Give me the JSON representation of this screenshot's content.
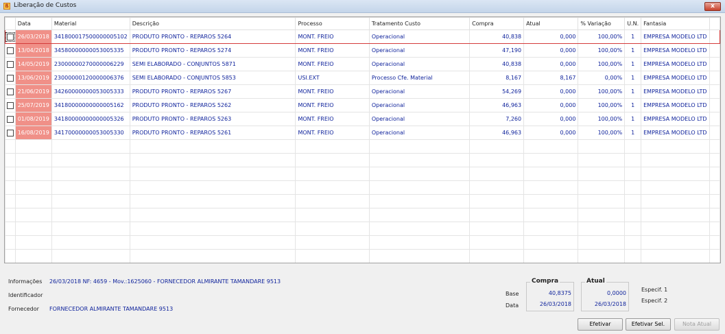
{
  "window": {
    "title": "Liberação de Custos",
    "close_label": "x"
  },
  "grid": {
    "columns": [
      "Data",
      "Material",
      "Descrição",
      "Processo",
      "Tratamento Custo",
      "Compra",
      "Atual",
      "% Variação",
      "U.N.",
      "Fantasia"
    ],
    "rows": [
      {
        "data": "26/03/2018",
        "material": "341800017500000005102",
        "descricao": "PRODUTO PRONTO - REPAROS 5264",
        "processo": "MONT. FREIO",
        "tratamento": "Operacional",
        "compra": "40,838",
        "atual": "0,000",
        "variacao": "100,00%",
        "un": "1",
        "fantasia": "EMPRESA MODELO LTD"
      },
      {
        "data": "13/04/2018",
        "material": "34580000000053005335",
        "descricao": "PRODUTO PRONTO - REPAROS 5274",
        "processo": "MONT. FREIO",
        "tratamento": "Operacional",
        "compra": "47,190",
        "atual": "0,000",
        "variacao": "100,00%",
        "un": "1",
        "fantasia": "EMPRESA MODELO LTD"
      },
      {
        "data": "14/05/2019",
        "material": "23000000270000006229",
        "descricao": "SEMI ELABORADO - CONJUNTOS 5871",
        "processo": "MONT. FREIO",
        "tratamento": "Operacional",
        "compra": "40,838",
        "atual": "0,000",
        "variacao": "100,00%",
        "un": "1",
        "fantasia": "EMPRESA MODELO LTD"
      },
      {
        "data": "13/06/2019",
        "material": "23000000120000006376",
        "descricao": "SEMI ELABORADO - CONJUNTOS 5853",
        "processo": "USI.EXT",
        "tratamento": "Processo Cfe. Material",
        "compra": "8,167",
        "atual": "8,167",
        "variacao": "0,00%",
        "un": "1",
        "fantasia": "EMPRESA MODELO LTD"
      },
      {
        "data": "21/06/2019",
        "material": "34260000000053005333",
        "descricao": "PRODUTO PRONTO - REPAROS 5267",
        "processo": "MONT. FREIO",
        "tratamento": "Operacional",
        "compra": "54,269",
        "atual": "0,000",
        "variacao": "100,00%",
        "un": "1",
        "fantasia": "EMPRESA MODELO LTD"
      },
      {
        "data": "25/07/2019",
        "material": "34180000000000005162",
        "descricao": "PRODUTO PRONTO - REPAROS 5262",
        "processo": "MONT. FREIO",
        "tratamento": "Operacional",
        "compra": "46,963",
        "atual": "0,000",
        "variacao": "100,00%",
        "un": "1",
        "fantasia": "EMPRESA MODELO LTD"
      },
      {
        "data": "01/08/2019",
        "material": "34180000000000005326",
        "descricao": "PRODUTO PRONTO - REPAROS 5263",
        "processo": "MONT. FREIO",
        "tratamento": "Operacional",
        "compra": "7,260",
        "atual": "0,000",
        "variacao": "100,00%",
        "un": "1",
        "fantasia": "EMPRESA MODELO LTD"
      },
      {
        "data": "16/08/2019",
        "material": "34170000000053005330",
        "descricao": "PRODUTO PRONTO - REPAROS 5261",
        "processo": "MONT. FREIO",
        "tratamento": "Operacional",
        "compra": "46,963",
        "atual": "0,000",
        "variacao": "100,00%",
        "un": "1",
        "fantasia": "EMPRESA MODELO LTD"
      }
    ],
    "empty_rows": 9
  },
  "info": {
    "informacoes_label": "Informações",
    "informacoes_value": "26/03/2018 NF: 4659 - Mov.:1625060 - FORNECEDOR ALMIRANTE TAMANDARE 9513",
    "identificador_label": "Identificador",
    "identificador_value": "",
    "fornecedor_label": "Fornecedor",
    "fornecedor_value": "FORNECEDOR ALMIRANTE TAMANDARE 9513"
  },
  "summary": {
    "base_label": "Base",
    "data_label": "Data",
    "compra_title": "Compra",
    "atual_title": "Atual",
    "compra_base": "40,8375",
    "compra_data": "26/03/2018",
    "atual_base": "0,0000",
    "atual_data": "26/03/2018",
    "especif1": "Especif. 1",
    "especif2": "Especif. 2"
  },
  "buttons": {
    "efetivar": "Efetivar",
    "efetivar_sel": "Efetivar Sel.",
    "nota_atual": "Nota Atual"
  },
  "colors": {
    "date_cell": "#f09088",
    "value_text": "#0b1f9a",
    "selected_border": "#d43a3a"
  }
}
